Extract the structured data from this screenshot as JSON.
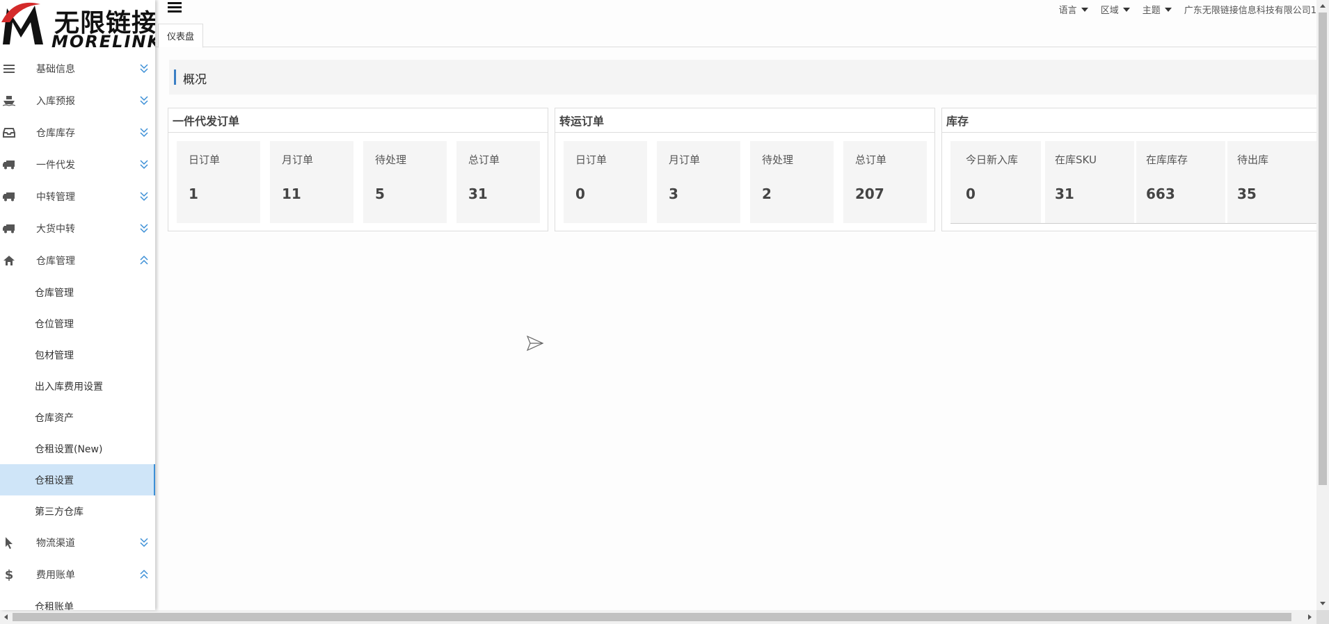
{
  "logo": {
    "cn": "无限链接",
    "en": "MORELINK"
  },
  "sidebar": {
    "items": [
      {
        "label": "基础信息",
        "icon": "list-icon",
        "expanded": false
      },
      {
        "label": "入库预报",
        "icon": "ship-icon",
        "expanded": false
      },
      {
        "label": "仓库库存",
        "icon": "inbox-icon",
        "expanded": false
      },
      {
        "label": "一件代发",
        "icon": "truck-icon",
        "expanded": false
      },
      {
        "label": "中转管理",
        "icon": "truck-icon",
        "expanded": false
      },
      {
        "label": "大货中转",
        "icon": "truck-icon",
        "expanded": false
      },
      {
        "label": "仓库管理",
        "icon": "home-icon",
        "expanded": true
      },
      {
        "label": "物流渠道",
        "icon": "pointer-icon",
        "expanded": false
      },
      {
        "label": "费用账单",
        "icon": "dollar-icon",
        "expanded": true
      }
    ],
    "warehouse_sub": [
      "仓库管理",
      "仓位管理",
      "包材管理",
      "出入库费用设置",
      "仓库资产",
      "仓租设置(New)",
      "仓租设置",
      "第三方仓库"
    ],
    "active_sub": "仓租设置",
    "billing_sub": [
      "仓租账单"
    ]
  },
  "header": {
    "language": "语言",
    "region": "区域",
    "theme": "主题",
    "company": "广东无限链接信息科技有限公司1"
  },
  "tabs": [
    {
      "label": "仪表盘"
    }
  ],
  "overview": {
    "title": "概况"
  },
  "panels": {
    "dropship": {
      "title": "一件代发订单",
      "stats": [
        {
          "label": "日订单",
          "value": "1"
        },
        {
          "label": "月订单",
          "value": "11"
        },
        {
          "label": "待处理",
          "value": "5"
        },
        {
          "label": "总订单",
          "value": "31"
        }
      ]
    },
    "transit": {
      "title": "转运订单",
      "stats": [
        {
          "label": "日订单",
          "value": "0"
        },
        {
          "label": "月订单",
          "value": "3"
        },
        {
          "label": "待处理",
          "value": "2"
        },
        {
          "label": "总订单",
          "value": "207"
        }
      ]
    },
    "stock": {
      "title": "库存",
      "stats": [
        {
          "label": "今日新入库",
          "value": "0"
        },
        {
          "label": "在库SKU",
          "value": "31"
        },
        {
          "label": "在库库存",
          "value": "663"
        },
        {
          "label": "待出库",
          "value": "35"
        }
      ]
    }
  },
  "colors": {
    "accent": "#3b8fd6",
    "active_bg": "#cfe5f8",
    "logo_red": "#d42a2a"
  }
}
